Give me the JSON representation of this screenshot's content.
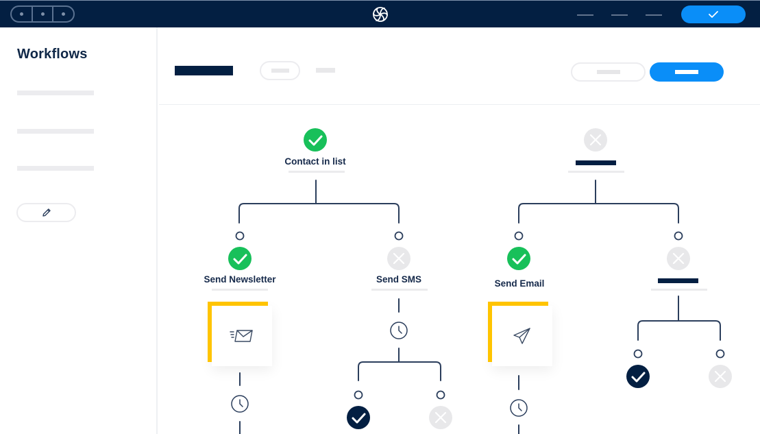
{
  "topbar": {
    "window_controls": [
      "dot",
      "dot",
      "dot"
    ],
    "logo_icon": "brand-swirl-icon",
    "menu_placeholders": 3,
    "confirm_button_icon": "check-icon",
    "colors": {
      "background": "#031f42",
      "accent": "#0a8ef8"
    }
  },
  "sidebar": {
    "title": "Workflows",
    "item_placeholders": 3,
    "edit_button_icon": "pencil-icon"
  },
  "header": {
    "title_placeholder": "dark-bar",
    "pill_placeholder": "pill",
    "tab_placeholder": "bar",
    "secondary_button": "placeholder",
    "primary_button": "placeholder"
  },
  "workflow": {
    "colors": {
      "success": "#18c05a",
      "inactive": "#e8e8ea",
      "done": "#031f42",
      "connector": "#2b3e5c",
      "highlight": "#ffc400"
    },
    "trees": [
      {
        "root": {
          "label": "Contact in list",
          "status": "success"
        },
        "branches": [
          {
            "label": "Send Newsletter",
            "status": "success",
            "action_icon": "mail-fast-icon",
            "then": "wait-clock"
          },
          {
            "label": "Send SMS",
            "status": "inactive",
            "then": "wait-clock",
            "outcomes": [
              {
                "status": "done"
              },
              {
                "status": "inactive"
              }
            ]
          }
        ]
      },
      {
        "root": {
          "label": "",
          "status": "inactive"
        },
        "branches": [
          {
            "label": "Send Email",
            "status": "success",
            "action_icon": "send-paper-plane-icon",
            "then": "wait-clock"
          },
          {
            "label": "",
            "status": "inactive",
            "outcomes": [
              {
                "status": "done"
              },
              {
                "status": "inactive"
              }
            ]
          }
        ]
      }
    ]
  }
}
